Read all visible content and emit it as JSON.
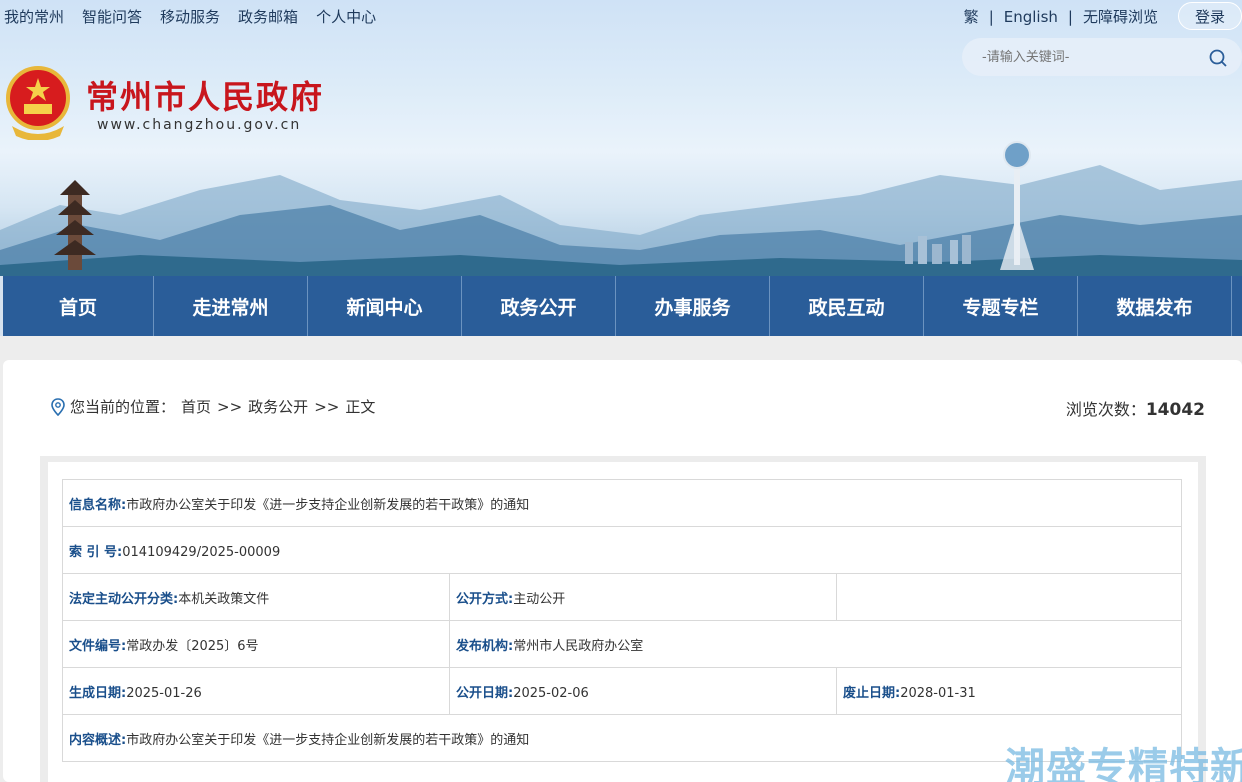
{
  "header": {
    "top_links": [
      "我的常州",
      "智能问答",
      "移动服务",
      "政务邮箱",
      "个人中心"
    ],
    "right_links": {
      "traditional": "繁",
      "english": "English",
      "accessible": "无障碍浏览"
    },
    "login": "登录",
    "search_placeholder": "-请输入关键词-",
    "site_title": "常州市人民政府",
    "site_url": "www.changzhou.gov.cn"
  },
  "nav": [
    "首页",
    "走进常州",
    "新闻中心",
    "政务公开",
    "办事服务",
    "政民互动",
    "专题专栏",
    "数据发布"
  ],
  "breadcrumb": {
    "prefix": "您当前的位置：",
    "items": [
      "首页",
      ">>",
      "政务公开",
      ">>",
      "正文"
    ]
  },
  "views": {
    "label": "浏览次数：",
    "count": "14042"
  },
  "meta": {
    "info_name_label": "信息名称:",
    "info_name": "市政府办公室关于印发《进一步支持企业创新发展的若干政策》的通知",
    "index_label": "索 引 号:",
    "index": "014109429/2025-00009",
    "category_label": "法定主动公开分类:",
    "category": "本机关政策文件",
    "mode_label": "公开方式:",
    "mode": "主动公开",
    "doc_no_label": "文件编号:",
    "doc_no": "常政办发〔2025〕6号",
    "publisher_label": "发布机构:",
    "publisher": "常州市人民政府办公室",
    "created_label": "生成日期:",
    "created": "2025-01-26",
    "open_label": "公开日期:",
    "open": "2025-02-06",
    "expire_label": "废止日期:",
    "expire": "2028-01-31",
    "summary_label": "内容概述:",
    "summary": "市政府办公室关于印发《进一步支持企业创新发展的若干政策》的通知"
  },
  "watermark": "潮盛专精特新",
  "colors": {
    "nav": "#2a5d99",
    "title_red": "#c8161d",
    "label_blue": "#1a4f8b"
  }
}
